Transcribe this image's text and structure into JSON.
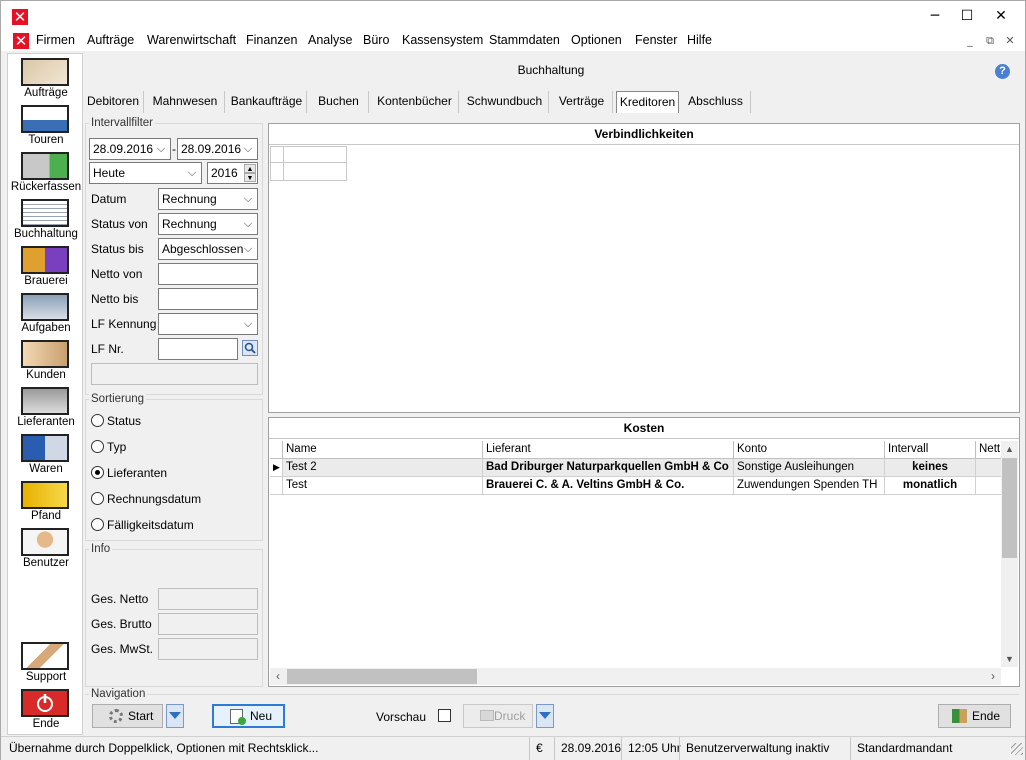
{
  "window": {
    "minimize_glyph": "─",
    "maximize_glyph": "☐",
    "close_glyph": "✕"
  },
  "menu": {
    "items": [
      "Firmen",
      "Aufträge",
      "Warenwirtschaft",
      "Finanzen",
      "Analyse",
      "Büro",
      "Kassensystem",
      "Stammdaten",
      "Optionen",
      "Fenster",
      "Hilfe"
    ],
    "mdi_minimize": "_",
    "mdi_restore": "⧉",
    "mdi_close": "✕"
  },
  "sidebar": {
    "items": [
      {
        "label": "Aufträge",
        "icon": "headset-agent-icon"
      },
      {
        "label": "Touren",
        "icon": "truck-icon"
      },
      {
        "label": "Rückerfassen",
        "icon": "truck-return-icon"
      },
      {
        "label": "Buchhaltung",
        "icon": "ledger-icon"
      },
      {
        "label": "Brauerei",
        "icon": "brewery-icon"
      },
      {
        "label": "Aufgaben",
        "icon": "tasks-icon"
      },
      {
        "label": "Kunden",
        "icon": "customers-icon"
      },
      {
        "label": "Lieferanten",
        "icon": "suppliers-icon"
      },
      {
        "label": "Waren",
        "icon": "goods-icon"
      },
      {
        "label": "Pfand",
        "icon": "crates-icon"
      },
      {
        "label": "Benutzer",
        "icon": "user-lock-icon"
      },
      {
        "label": "Support",
        "icon": "handshake-icon"
      },
      {
        "label": "Ende",
        "icon": "power-icon"
      }
    ]
  },
  "header": {
    "title": "Buchhaltung",
    "help_glyph": "?"
  },
  "tabs": [
    "Debitoren",
    "Mahnwesen",
    "Bankaufträge",
    "Buchen",
    "Kontenbücher",
    "Schwundbuch",
    "Verträge",
    "Kreditoren",
    "Abschluss"
  ],
  "filter": {
    "group_title": "Intervallfilter",
    "date_from": "28.09.2016",
    "date_sep": "-",
    "date_to": "28.09.2016",
    "period": "Heute",
    "year": "2016",
    "datum_label": "Datum",
    "datum_value": "Rechnung",
    "status_von_label": "Status von",
    "status_von_value": "Rechnung",
    "status_bis_label": "Status bis",
    "status_bis_value": "Abgeschlossen",
    "netto_von_label": "Netto von",
    "netto_bis_label": "Netto bis",
    "lf_kennung_label": "LF Kennung",
    "lf_nr_label": "LF Nr."
  },
  "sort": {
    "group_title": "Sortierung",
    "options": [
      "Status",
      "Typ",
      "Lieferanten",
      "Rechnungsdatum",
      "Fälligkeitsdatum"
    ],
    "selected": "Lieferanten"
  },
  "info": {
    "group_title": "Info",
    "ges_netto": "Ges. Netto",
    "ges_brutto": "Ges. Brutto",
    "ges_mwst": "Ges. MwSt."
  },
  "liabilities": {
    "title": "Verbindlichkeiten"
  },
  "costs": {
    "title": "Kosten",
    "columns": [
      "Name",
      "Lieferant",
      "Konto",
      "Intervall",
      "Nett"
    ],
    "rows": [
      {
        "name": "Test 2",
        "lieferant": "Bad Driburger Naturparkquellen GmbH & Co",
        "konto": "Sonstige Ausleihungen",
        "intervall": "keines"
      },
      {
        "name": "Test",
        "lieferant": "Brauerei C. & A. Veltins GmbH & Co.",
        "konto": "Zuwendungen Spenden TH",
        "intervall": "monatlich"
      }
    ]
  },
  "navigation": {
    "group_title": "Navigation",
    "start_label": "Start",
    "neu_label": "Neu",
    "vorschau_label": "Vorschau",
    "druck_label": "Druck",
    "ende_label": "Ende"
  },
  "statusbar": {
    "hint": "Übernahme durch Doppelklick, Optionen mit Rechtsklick...",
    "currency": "€",
    "date": "28.09.2016",
    "time": "12:05 Uhr",
    "user_admin": "Benutzerverwaltung inaktiv",
    "tenant": "Standardmandant"
  },
  "colors": {
    "accent_red": "#e81123",
    "selection_blue": "#2e7bd6"
  }
}
